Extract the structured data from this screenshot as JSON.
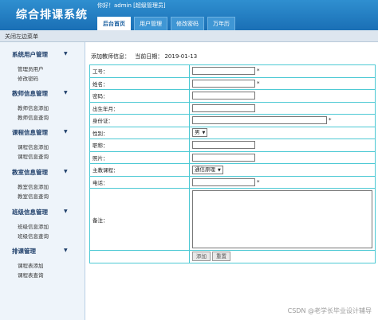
{
  "app": {
    "title": "综合排课系统",
    "greeting": "你好！admin [超级管理员]"
  },
  "nav": {
    "tabs": [
      {
        "label": "后台首页",
        "active": true
      },
      {
        "label": "用户管理",
        "active": false
      },
      {
        "label": "修改密码",
        "active": false
      },
      {
        "label": "万年历",
        "active": false
      }
    ]
  },
  "subbar": {
    "label": "关闭左边菜单"
  },
  "sidebar": {
    "groups": [
      {
        "title": "系统用户管理",
        "items": [
          "管理员用户",
          "修改密码"
        ]
      },
      {
        "title": "教师信息管理",
        "items": [
          "教师信息添加",
          "教师信息查询"
        ]
      },
      {
        "title": "课程信息管理",
        "items": [
          "课程信息添加",
          "课程信息查询"
        ]
      },
      {
        "title": "教室信息管理",
        "items": [
          "教室信息添加",
          "教室信息查询"
        ]
      },
      {
        "title": "班级信息管理",
        "items": [
          "班级信息添加",
          "班级信息查询"
        ]
      },
      {
        "title": "排课管理",
        "items": [
          "课程表添加",
          "课程表查询"
        ]
      }
    ]
  },
  "main": {
    "breadcrumb": "添加教师信息：",
    "date_label": "当前日期：",
    "date": "2019-01-13",
    "form": {
      "fields": {
        "id": "工号：",
        "name": "姓名：",
        "password": "密码：",
        "birth": "出生年月：",
        "idcard": "身份证：",
        "gender": "性别：",
        "title": "职称：",
        "photo": "照片：",
        "course": "主教课程：",
        "phone": "电话：",
        "remark": "备注："
      },
      "required_mark": "*",
      "gender_value": "男",
      "course_value": "通信原理",
      "submit_label": "添加",
      "reset_label": "重置"
    }
  },
  "watermark": "CSDN @老学长毕业设计辅导",
  "colors": {
    "header": "#1a6fb5",
    "sidebar_bg": "#eef4fa",
    "table_border": "#4cc9d4"
  }
}
